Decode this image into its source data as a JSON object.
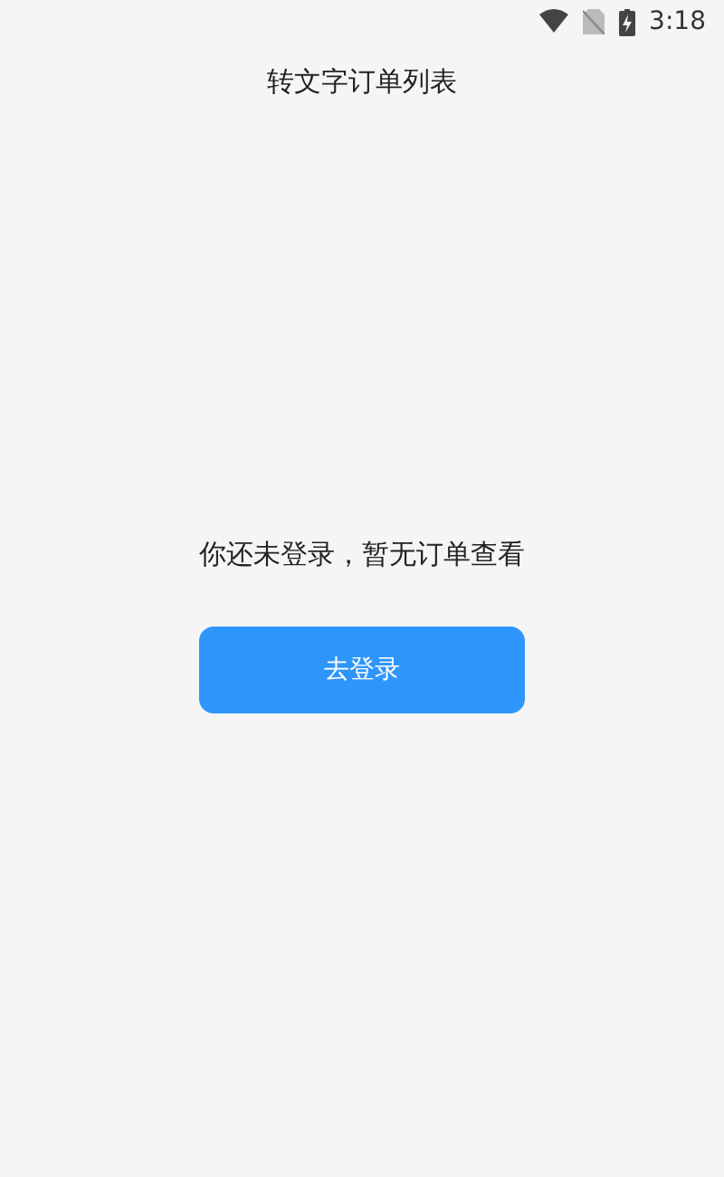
{
  "status_bar": {
    "time": "3:18"
  },
  "header": {
    "title": "转文字订单列表"
  },
  "empty_state": {
    "message": "你还未登录，暂无订单查看",
    "button": "去登录"
  }
}
